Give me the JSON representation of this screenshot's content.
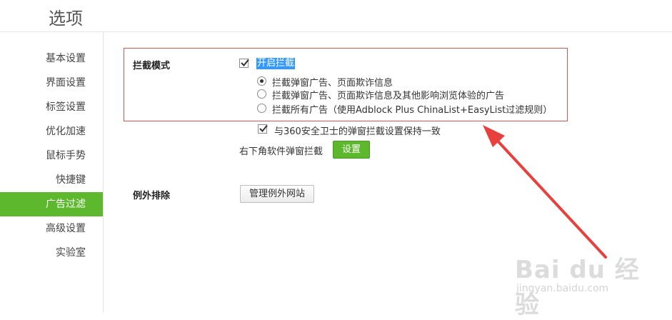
{
  "page": {
    "title": "选项"
  },
  "sidebar": {
    "items": [
      {
        "label": "基本设置"
      },
      {
        "label": "界面设置"
      },
      {
        "label": "标签设置"
      },
      {
        "label": "优化加速"
      },
      {
        "label": "鼠标手势"
      },
      {
        "label": "快捷键"
      },
      {
        "label": "广告过滤",
        "active": true
      },
      {
        "label": "高级设置"
      },
      {
        "label": "实验室"
      }
    ]
  },
  "intercept": {
    "label": "拦截模式",
    "enable_label": "开启拦截",
    "enable_checked": true,
    "options": [
      {
        "label": "拦截弹窗广告、页面欺诈信息",
        "selected": true
      },
      {
        "label": "拦截弹窗广告、页面欺诈信息及其他影响浏览体验的广告",
        "selected": false
      },
      {
        "label": "拦截所有广告（使用Adblock Plus ChinaList+EasyList过滤规则）",
        "selected": false
      }
    ],
    "sync_label": "与360安全卫士的弹窗拦截设置保持一致",
    "sync_checked": true,
    "popup_label": "右下角软件弹窗拦截",
    "popup_button": "设置"
  },
  "exceptions": {
    "label": "例外排除",
    "button": "管理例外网站"
  },
  "watermark": {
    "main": "Bai du 经验",
    "sub": "jingyan.baidu.com"
  },
  "colors": {
    "accent": "#5db82e",
    "highlight_border": "#d9534f",
    "arrow": "#e8403c",
    "selection": "#3399ff"
  }
}
